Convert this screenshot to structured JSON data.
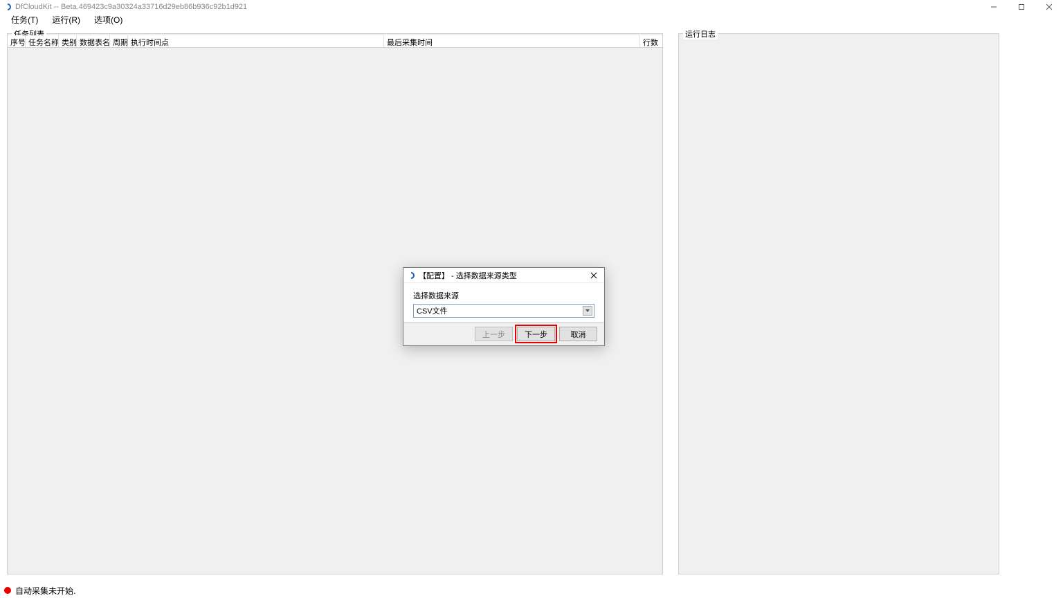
{
  "window": {
    "title": "DfCloudKit -- Beta.469423c9a30324a33716d29eb86b936c92b1d921"
  },
  "menu": {
    "tasks": "任务(T)",
    "run": "运行(R)",
    "options": "选项(O)"
  },
  "panels": {
    "tasklist_legend": "任务列表",
    "log_legend": "运行日志"
  },
  "table": {
    "columns": {
      "index": "序号",
      "name": "任务名称",
      "category": "类别",
      "dataname": "数据表名",
      "period": "周期",
      "exectime": "执行时间点",
      "lastcollect": "最后采集时间",
      "rows": "行数"
    }
  },
  "dialog": {
    "title": "【配置】 - 选择数据来源类型",
    "label": "选择数据来源",
    "selected": "CSV文件",
    "prev": "上一步",
    "next": "下一步",
    "cancel": "取消"
  },
  "status": {
    "text": "自动采集未开始."
  }
}
